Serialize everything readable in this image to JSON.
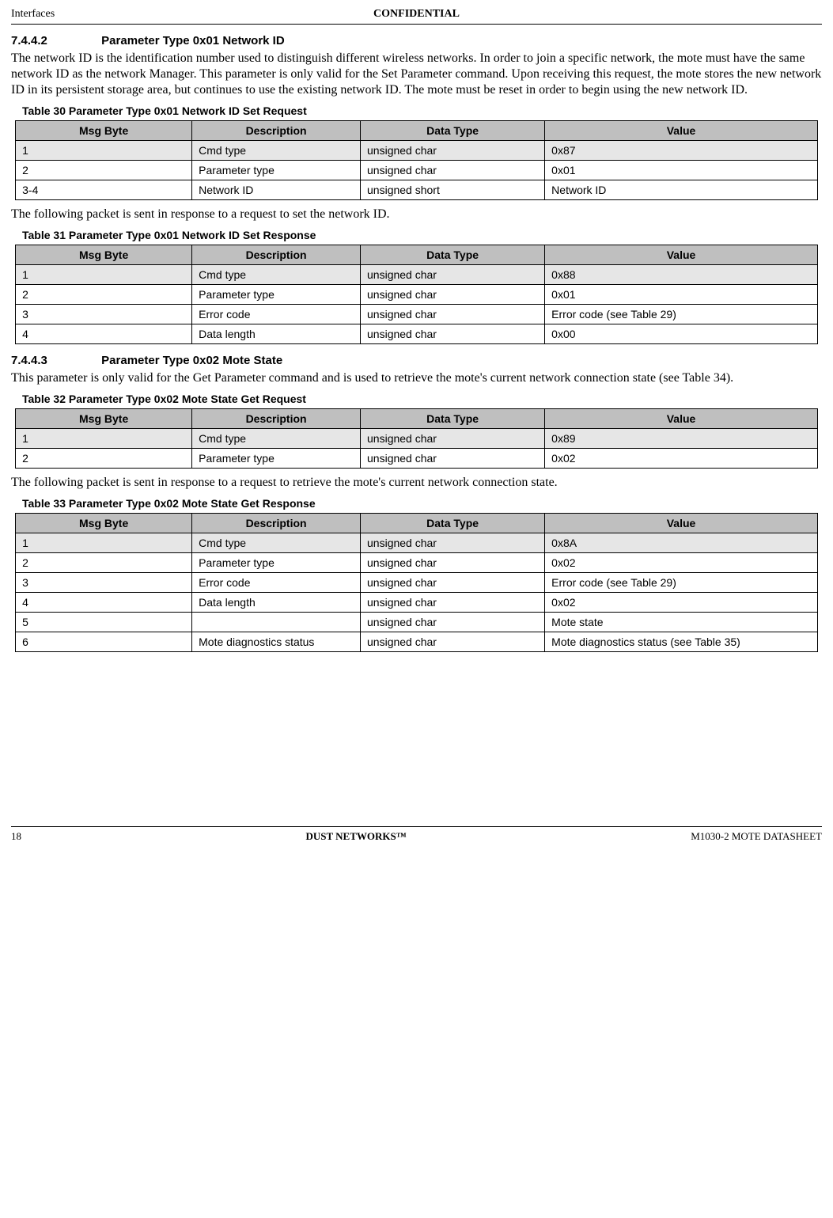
{
  "header": {
    "left": "Interfaces",
    "center": "CONFIDENTIAL"
  },
  "section1": {
    "num": "7.4.4.2",
    "title": "Parameter Type 0x01 Network ID",
    "body": "The network ID is the identification number used to distinguish different wireless networks. In order to join a specific network, the mote must have the same network ID as the network Manager. This parameter is only valid for the Set Parameter command. Upon receiving this request, the mote stores the new network ID in its persistent storage area, but continues to use the existing network ID. The mote must be reset in order to begin using the new network ID."
  },
  "table30": {
    "caption": "Table 30    Parameter Type 0x01 Network ID Set Request",
    "headers": {
      "c1": "Msg Byte",
      "c2": "Description",
      "c3": "Data Type",
      "c4": "Value"
    },
    "rows": [
      {
        "c1": "1",
        "c2": "Cmd type",
        "c3": "unsigned char",
        "c4": "0x87",
        "shaded": true
      },
      {
        "c1": "2",
        "c2": "Parameter type",
        "c3": "unsigned char",
        "c4": "0x01",
        "shaded": false
      },
      {
        "c1": "3-4",
        "c2": "Network ID",
        "c3": "unsigned short",
        "c4": "Network ID",
        "shaded": false
      }
    ]
  },
  "text_after_t30": "The following packet is sent in response to a request to set the network ID.",
  "table31": {
    "caption": "Table 31    Parameter Type 0x01 Network ID Set Response",
    "headers": {
      "c1": "Msg Byte",
      "c2": "Description",
      "c3": "Data Type",
      "c4": "Value"
    },
    "rows": [
      {
        "c1": "1",
        "c2": "Cmd type",
        "c3": "unsigned char",
        "c4": "0x88",
        "shaded": true
      },
      {
        "c1": "2",
        "c2": "Parameter type",
        "c3": "unsigned char",
        "c4": "0x01",
        "shaded": false
      },
      {
        "c1": "3",
        "c2": "Error code",
        "c3": "unsigned char",
        "c4": "Error code (see Table 29)",
        "shaded": false
      },
      {
        "c1": "4",
        "c2": "Data length",
        "c3": "unsigned char",
        "c4": "0x00",
        "shaded": false
      }
    ]
  },
  "section2": {
    "num": "7.4.4.3",
    "title": "Parameter Type 0x02 Mote State",
    "body": "This parameter is only valid for the Get Parameter command and is used to retrieve the mote's current network connection state (see Table 34)."
  },
  "table32": {
    "caption": "Table 32    Parameter Type 0x02 Mote State Get Request",
    "headers": {
      "c1": "Msg Byte",
      "c2": "Description",
      "c3": "Data Type",
      "c4": "Value"
    },
    "rows": [
      {
        "c1": "1",
        "c2": "Cmd type",
        "c3": "unsigned char",
        "c4": "0x89",
        "shaded": true
      },
      {
        "c1": "2",
        "c2": "Parameter type",
        "c3": "unsigned char",
        "c4": "0x02",
        "shaded": false
      }
    ]
  },
  "text_after_t32": "The following packet is sent in response to a request to retrieve the mote's current network connection state.",
  "table33": {
    "caption": "Table 33    Parameter Type 0x02 Mote State Get Response",
    "headers": {
      "c1": "Msg Byte",
      "c2": "Description",
      "c3": "Data Type",
      "c4": "Value"
    },
    "rows": [
      {
        "c1": "1",
        "c2": "Cmd type",
        "c3": "unsigned char",
        "c4": "0x8A",
        "shaded": true
      },
      {
        "c1": "2",
        "c2": "Parameter type",
        "c3": "unsigned char",
        "c4": "0x02",
        "shaded": false
      },
      {
        "c1": "3",
        "c2": "Error code",
        "c3": "unsigned char",
        "c4": "Error code (see Table 29)",
        "shaded": false
      },
      {
        "c1": "4",
        "c2": "Data length",
        "c3": "unsigned char",
        "c4": "0x02",
        "shaded": false
      },
      {
        "c1": "5",
        "c2": "",
        "c3": "unsigned char",
        "c4": "Mote state",
        "shaded": false
      },
      {
        "c1": "6",
        "c2": "Mote diagnostics status",
        "c3": "unsigned char",
        "c4": "Mote diagnostics status (see Table 35)",
        "shaded": false
      }
    ]
  },
  "footer": {
    "left": "18",
    "center": "DUST NETWORKS™",
    "right": "M1030-2 MOTE DATASHEET"
  }
}
